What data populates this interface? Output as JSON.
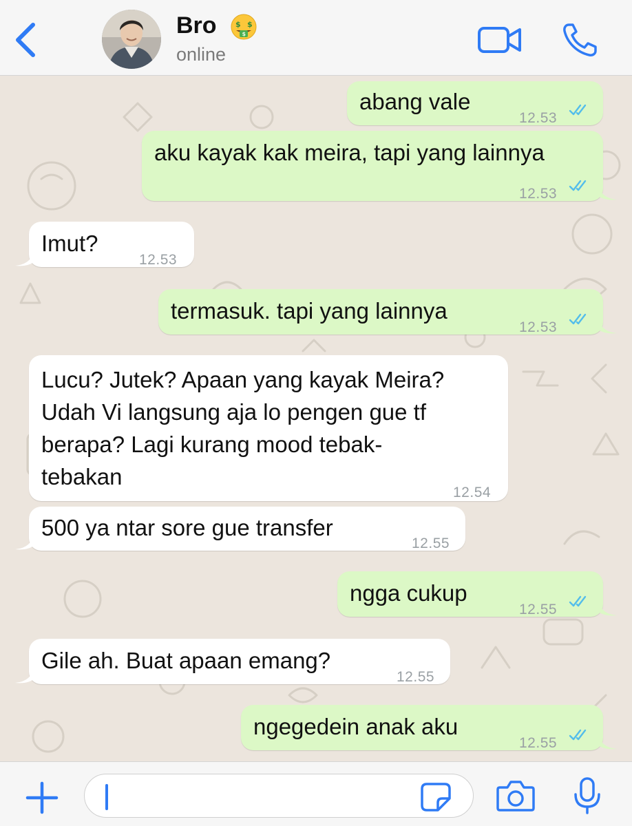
{
  "header": {
    "contact_name": "Bro",
    "status": "online"
  },
  "messages": [
    {
      "direction": "outgoing",
      "text": "abang vale",
      "time": "12.53",
      "read": true
    },
    {
      "direction": "outgoing",
      "text": "aku kayak kak meira, tapi yang lainnya",
      "time": "12.53",
      "read": true
    },
    {
      "direction": "incoming",
      "text": "Imut?",
      "time": "12.53"
    },
    {
      "direction": "outgoing",
      "text": "termasuk. tapi yang lainnya",
      "time": "12.53",
      "read": true
    },
    {
      "direction": "incoming",
      "lines": [
        "Lucu? Jutek? Apaan yang kayak Meira?",
        "Udah Vi langsung aja lo pengen gue tf",
        "berapa? Lagi kurang mood tebak-",
        "tebakan"
      ],
      "time": "12.54"
    },
    {
      "direction": "incoming",
      "text": "500 ya ntar sore gue transfer",
      "time": "12.55"
    },
    {
      "direction": "outgoing",
      "text": "ngga cukup",
      "time": "12.55",
      "read": true
    },
    {
      "direction": "incoming",
      "text": "Gile ah. Buat apaan emang?",
      "time": "12.55"
    },
    {
      "direction": "outgoing",
      "text": "ngegedein anak aku",
      "time": "12.55",
      "read": true
    }
  ],
  "colors": {
    "accent": "#2f7bf5",
    "outgoing_bubble": "#dcf8c6",
    "incoming_bubble": "#ffffff",
    "read_ticks": "#53bdeb",
    "wallpaper": "#ece5dd"
  },
  "icons": {
    "back": "chevron-left-icon",
    "video": "video-camera-icon",
    "call": "phone-icon",
    "emoji": "money-mouth-face-emoji",
    "plus": "plus-icon",
    "sticker": "sticker-icon",
    "camera": "camera-icon",
    "mic": "microphone-icon"
  }
}
